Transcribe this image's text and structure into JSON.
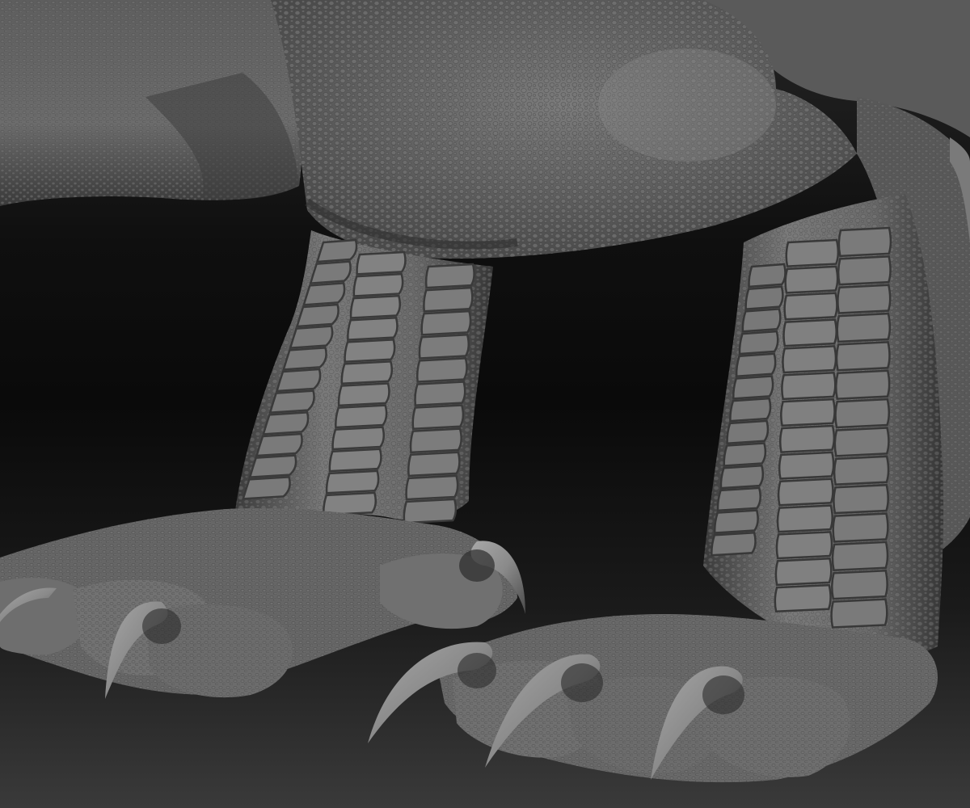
{
  "scene": {
    "subject": "sculpted-creature-feet",
    "material": "matcap-gray-clay",
    "background_top_color": "#262626",
    "background_mid_color": "#0a0a0a",
    "background_bottom_color": "#3a3a3a",
    "skin_color": "#6e6e6e",
    "skin_shadow_color": "#3c3c3c",
    "skin_highlight_color": "#9a9a9a",
    "claw_color": "#8c8c8c"
  }
}
